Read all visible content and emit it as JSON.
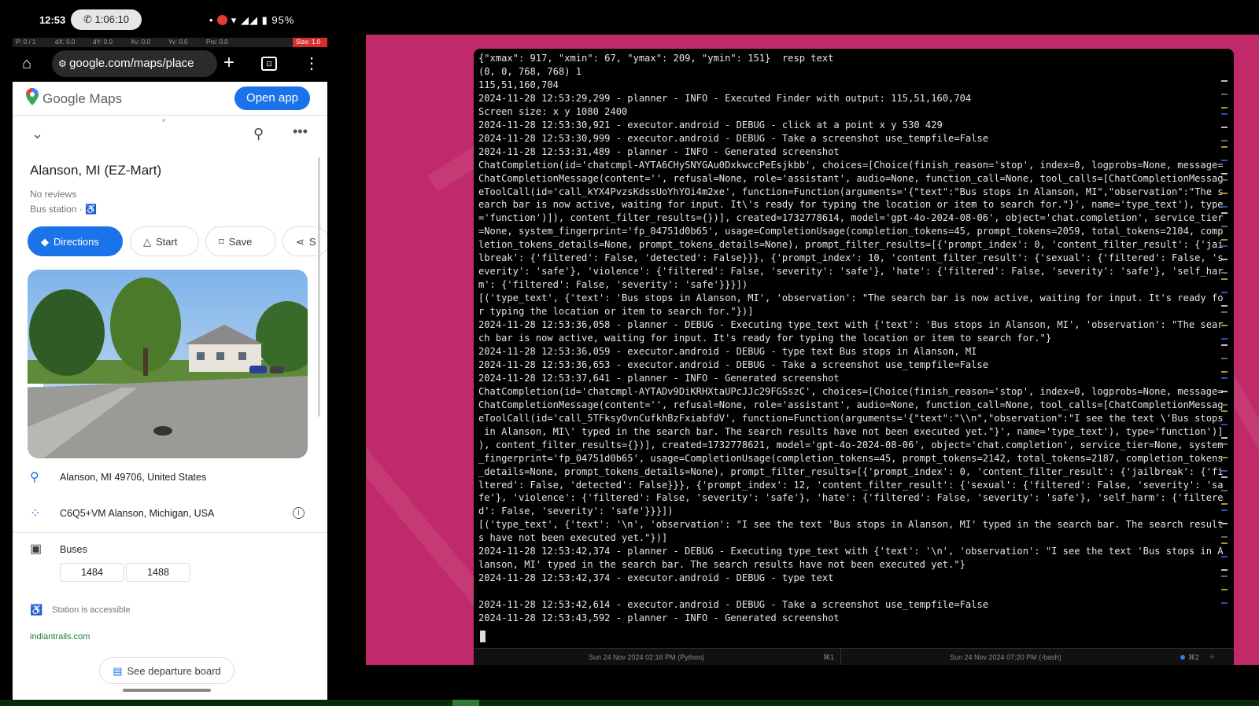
{
  "phone": {
    "status_bar": {
      "time": "12:53",
      "call_timer": "1:06:10",
      "battery": "95%"
    },
    "debug_bar": {
      "items": [
        "P: 0 / 1",
        "dX: 0.0",
        "dY: 0.0",
        "Xv: 0.0",
        "Yv: 0.0",
        "Prs: 0.0"
      ],
      "size": "Size: 1.0"
    },
    "browser": {
      "url": "google.com/maps/place"
    },
    "maps": {
      "logo_text": "Google Maps",
      "open_app": "Open app",
      "place": {
        "title": "Alanson, MI (EZ-Mart)",
        "reviews": "No reviews",
        "type": "Bus station · "
      },
      "actions": {
        "directions": "Directions",
        "start": "Start",
        "save": "Save",
        "share": "S"
      },
      "address": "Alanson, MI 49706, United States",
      "plus_code": "C6Q5+VM Alanson, Michigan, USA",
      "buses_label": "Buses",
      "routes": [
        "1484",
        "1488"
      ],
      "accessible": "Station is accessible",
      "website": "indiantrails.com",
      "departure_board": "See departure board"
    }
  },
  "terminal": {
    "lines": [
      "{\"xmax\": 917, \"xmin\": 67, \"ymax\": 209, \"ymin\": 151}  resp text",
      "(0, 0, 768, 768) 1",
      "115,51,160,704",
      "2024-11-28 12:53:29,299 - planner - INFO - Executed Finder with output: 115,51,160,704",
      "Screen size: x y 1080 2400",
      "2024-11-28 12:53:30,921 - executor.android - DEBUG - click at a point x y 530 429",
      "2024-11-28 12:53:30,999 - executor.android - DEBUG - Take a screenshot use_tempfile=False",
      "2024-11-28 12:53:31,489 - planner - INFO - Generated screenshot",
      "ChatCompletion(id='chatcmpl-AYTA6CHySNYGAu0DxkwccPeEsjkbb', choices=[Choice(finish_reason='stop', index=0, logprobs=None, message=",
      "ChatCompletionMessage(content='', refusal=None, role='assistant', audio=None, function_call=None, tool_calls=[ChatCompletionMessag",
      "eToolCall(id='call_kYX4PvzsKdssUoYhYOi4m2xe', function=Function(arguments='{\"text\":\"Bus stops in Alanson, MI\",\"observation\":\"The s",
      "earch bar is now active, waiting for input. It\\'s ready for typing the location or item to search for.\"}', name='type_text'), type",
      "='function')]), content_filter_results={})], created=1732778614, model='gpt-4o-2024-08-06', object='chat.completion', service_tier",
      "=None, system_fingerprint='fp_04751d0b65', usage=CompletionUsage(completion_tokens=45, prompt_tokens=2059, total_tokens=2104, comp",
      "letion_tokens_details=None, prompt_tokens_details=None), prompt_filter_results=[{'prompt_index': 0, 'content_filter_result': {'jai",
      "lbreak': {'filtered': False, 'detected': False}}}, {'prompt_index': 10, 'content_filter_result': {'sexual': {'filtered': False, 's",
      "everity': 'safe'}, 'violence': {'filtered': False, 'severity': 'safe'}, 'hate': {'filtered': False, 'severity': 'safe'}, 'self_har",
      "m': {'filtered': False, 'severity': 'safe'}}}])",
      "[('type_text', {'text': 'Bus stops in Alanson, MI', 'observation': \"The search bar is now active, waiting for input. It's ready fo",
      "r typing the location or item to search for.\"})]",
      "2024-11-28 12:53:36,058 - planner - DEBUG - Executing type_text with {'text': 'Bus stops in Alanson, MI', 'observation': \"The sear",
      "ch bar is now active, waiting for input. It's ready for typing the location or item to search for.\"}",
      "2024-11-28 12:53:36,059 - executor.android - DEBUG - type text Bus stops in Alanson, MI",
      "2024-11-28 12:53:36,653 - executor.android - DEBUG - Take a screenshot use_tempfile=False",
      "2024-11-28 12:53:37,641 - planner - INFO - Generated screenshot",
      "ChatCompletion(id='chatcmpl-AYTADv9DiKRHXtaUPcJJc29FGSszC', choices=[Choice(finish_reason='stop', index=0, logprobs=None, message=",
      "ChatCompletionMessage(content='', refusal=None, role='assistant', audio=None, function_call=None, tool_calls=[ChatCompletionMessag",
      "eToolCall(id='call_5TFksyOvnCufkhBzFxiabfdV', function=Function(arguments='{\"text\":\"\\\\n\",\"observation\":\"I see the text \\'Bus stops",
      " in Alanson, MI\\' typed in the search bar. The search results have not been executed yet.\"}', name='type_text'), type='function')]",
      "), content_filter_results={})], created=1732778621, model='gpt-4o-2024-08-06', object='chat.completion', service_tier=None, system",
      "_fingerprint='fp_04751d0b65', usage=CompletionUsage(completion_tokens=45, prompt_tokens=2142, total_tokens=2187, completion_tokens",
      "_details=None, prompt_tokens_details=None), prompt_filter_results=[{'prompt_index': 0, 'content_filter_result': {'jailbreak': {'fi",
      "ltered': False, 'detected': False}}}, {'prompt_index': 12, 'content_filter_result': {'sexual': {'filtered': False, 'severity': 'sa",
      "fe'}, 'violence': {'filtered': False, 'severity': 'safe'}, 'hate': {'filtered': False, 'severity': 'safe'}, 'self_harm': {'filtere",
      "d': False, 'severity': 'safe'}}}])",
      "[('type_text', {'text': '\\n', 'observation': \"I see the text 'Bus stops in Alanson, MI' typed in the search bar. The search result",
      "s have not been executed yet.\"})]",
      "2024-11-28 12:53:42,374 - planner - DEBUG - Executing type_text with {'text': '\\n', 'observation': \"I see the text 'Bus stops in A",
      "lanson, MI' typed in the search bar. The search results have not been executed yet.\"}",
      "2024-11-28 12:53:42,374 - executor.android - DEBUG - type text",
      "",
      "2024-11-28 12:53:42,614 - executor.android - DEBUG - Take a screenshot use_tempfile=False",
      "2024-11-28 12:53:43,592 - planner - INFO - Generated screenshot"
    ],
    "status_left": "Sun 24 Nov 2024 02:16 PM (Python)",
    "status_left_key": "⌘1",
    "status_right": "Sun 24 Nov 2024 07:20 PM (-bash)",
    "status_right_key": "⌘2"
  },
  "colors": {
    "desktop_bg": "#c02a6a",
    "maps_blue": "#1a73e8",
    "terminal_bg": "#000000"
  },
  "icons": [
    "home-icon",
    "tune-icon",
    "plus-icon",
    "tabs-icon",
    "menu-icon",
    "chevron-down-icon",
    "search-icon",
    "more-icon",
    "directions-icon",
    "start-icon",
    "bookmark-icon",
    "share-icon",
    "location-pin-icon",
    "plus-code-icon",
    "info-icon",
    "bus-icon",
    "accessible-icon",
    "departure-board-icon"
  ]
}
